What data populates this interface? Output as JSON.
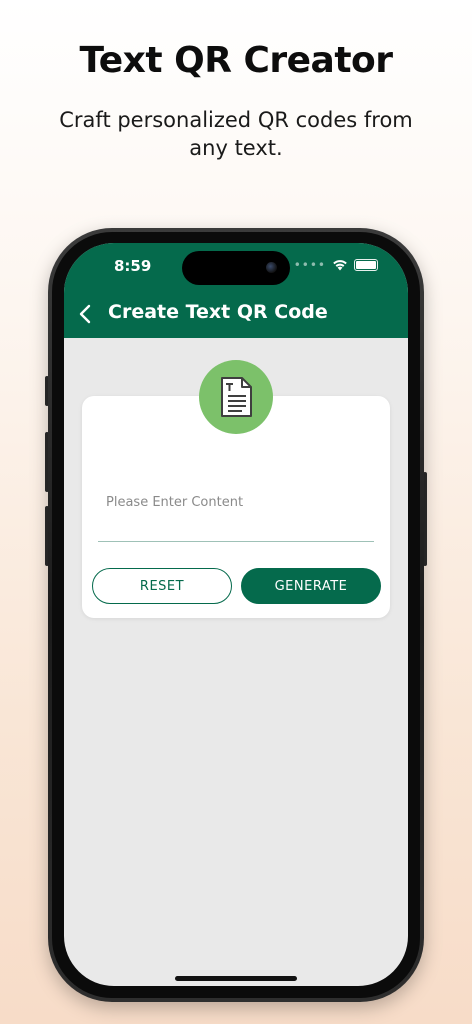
{
  "promo": {
    "title": "Text QR Creator",
    "subtitle": "Craft personalized QR codes from any text."
  },
  "status_bar": {
    "time": "8:59",
    "signal": "••••"
  },
  "header": {
    "title": "Create Text QR Code",
    "back_icon": "chevron-left-icon"
  },
  "form": {
    "badge_icon": "text-document-icon",
    "content_placeholder": "Please Enter Content",
    "content_value": "",
    "reset_label": "RESET",
    "generate_label": "GENERATE"
  },
  "colors": {
    "primary": "#056a4c",
    "badge": "#7cc16a",
    "screen_background": "#e9e9e9"
  }
}
